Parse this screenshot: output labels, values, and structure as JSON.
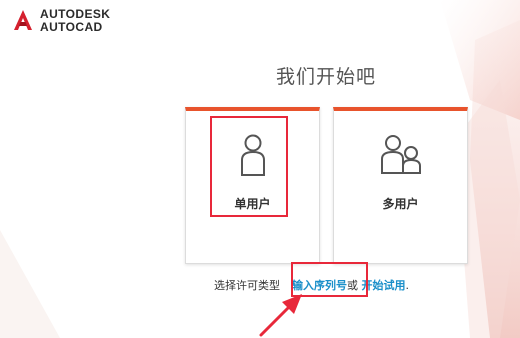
{
  "header": {
    "brand": "AUTODESK",
    "product": "AUTOCAD"
  },
  "main": {
    "title": "我们开始吧",
    "cards": [
      {
        "label": "单用户",
        "icon": "single-user-icon"
      },
      {
        "label": "多用户",
        "icon": "multi-user-icon"
      }
    ],
    "footer": {
      "prefix": "选择许可类型",
      "serial_link": "输入序列号",
      "or_text": "或",
      "trial_link": "开始试用",
      "period": "."
    }
  },
  "colors": {
    "accent": "#e8532c",
    "highlight": "#e8283a",
    "link": "#1a8fc9",
    "logo_red": "#d5202e"
  }
}
